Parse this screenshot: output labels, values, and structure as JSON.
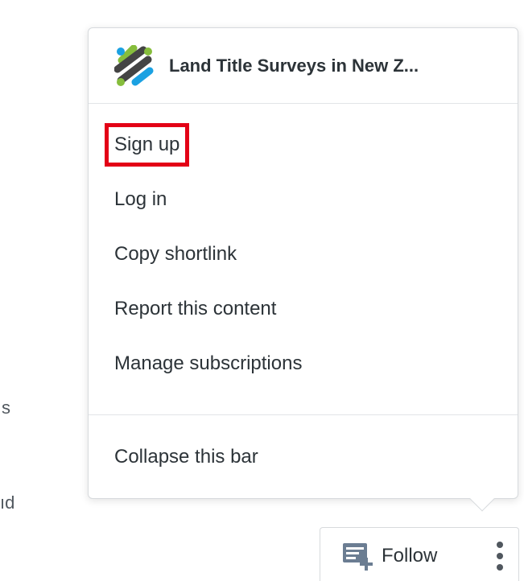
{
  "background_fragments": [
    "s",
    "ıd"
  ],
  "popup": {
    "site_title": "Land Title Surveys in New Z...",
    "logo_icon": "site-logo-icon",
    "menu_items": [
      {
        "label": "Sign up",
        "highlighted": true
      },
      {
        "label": "Log in"
      },
      {
        "label": "Copy shortlink"
      },
      {
        "label": "Report this content"
      },
      {
        "label": "Manage subscriptions"
      }
    ],
    "collapse_label": "Collapse this bar"
  },
  "follow_bar": {
    "follow_label": "Follow",
    "follow_icon": "reader-follow-icon",
    "more_icon": "vertical-ellipsis-icon"
  },
  "colors": {
    "highlight": "#e30016",
    "text": "#2c3338",
    "border": "#d7dadd",
    "logo_green": "#86bd3c",
    "logo_blue": "#1ba1e2",
    "logo_dark": "#444444",
    "icon_gray": "#6b7d92"
  }
}
